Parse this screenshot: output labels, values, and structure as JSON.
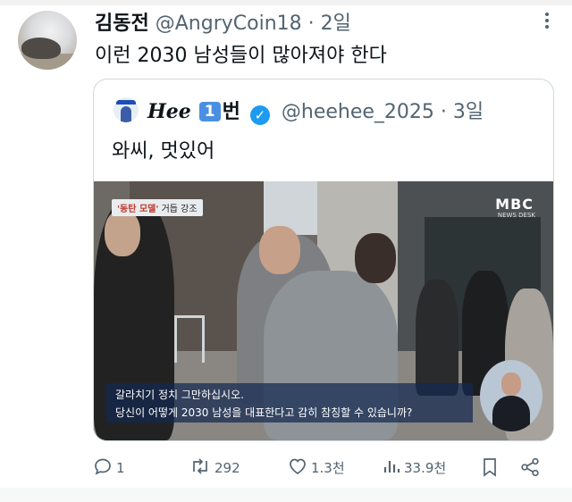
{
  "tweet": {
    "author_name": "김동전",
    "handle": "@AngryCoin18",
    "separator": "·",
    "time": "2일",
    "text": "이런 2030 남성들이 많아져야 한다"
  },
  "quote": {
    "name_prefix": "Hee",
    "name_number": "1",
    "name_suffix": "번",
    "verified_icon": "checkmark-badge-icon",
    "handle": "@heehee_2025",
    "separator": "·",
    "time": "3일",
    "text": "와씨, 멋있어",
    "media": {
      "caption_tag_highlight": "'동탄 모델'",
      "caption_tag_rest": " 거듭 강조",
      "broadcaster": "MBC",
      "broadcaster_sub": "NEWS DESK",
      "subtitle_line1": "갈라치기 정치 그만하십시오.",
      "subtitle_line2": "당신이 어떻게 2030 남성을 대표한다고 감히 참칭할 수 있습니까?"
    }
  },
  "actions": {
    "reply_count": "1",
    "retweet_count": "292",
    "like_count": "1.3천",
    "view_count": "33.9천"
  },
  "colors": {
    "text": "#0f1419",
    "secondary": "#536471",
    "verified": "#1d9bf0",
    "border": "#cfd9de"
  }
}
